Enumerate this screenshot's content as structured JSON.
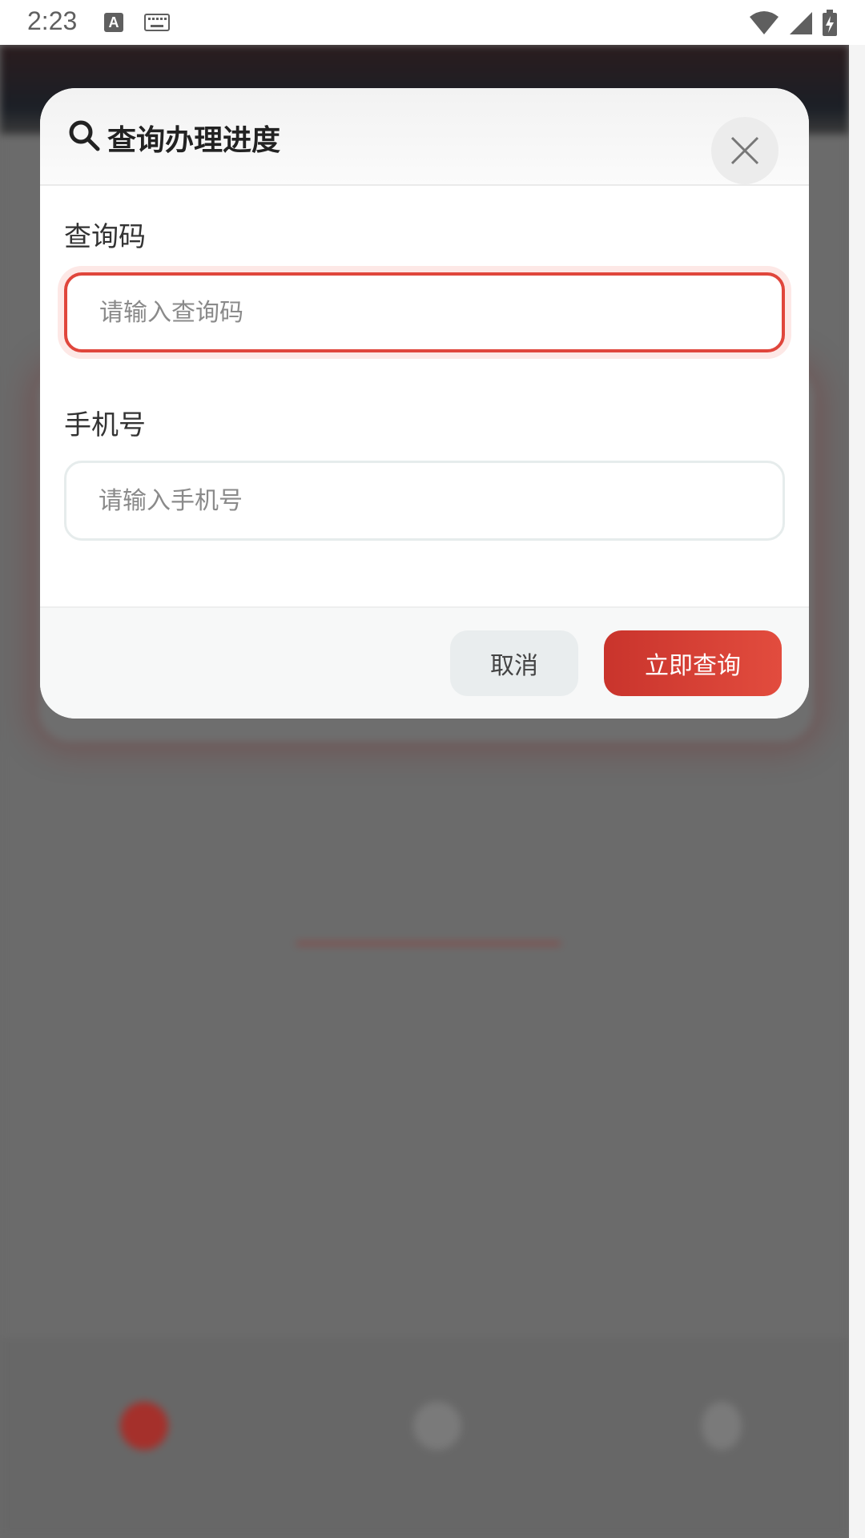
{
  "status_bar": {
    "time": "2:23",
    "icons": [
      "a-notification-icon",
      "keyboard-icon",
      "wifi-icon",
      "signal-icon",
      "battery-charging-icon"
    ]
  },
  "dialog": {
    "title": "查询办理进度",
    "fields": [
      {
        "label": "查询码",
        "placeholder": "请输入查询码",
        "value": ""
      },
      {
        "label": "手机号",
        "placeholder": "请输入手机号",
        "value": ""
      }
    ],
    "cancel_label": "取消",
    "submit_label": "立即查询"
  },
  "colors": {
    "accent": "#e0463c",
    "button_gradient_start": "#c9342c",
    "button_gradient_end": "#e24c3e",
    "overlay": "#6a6a6a"
  }
}
